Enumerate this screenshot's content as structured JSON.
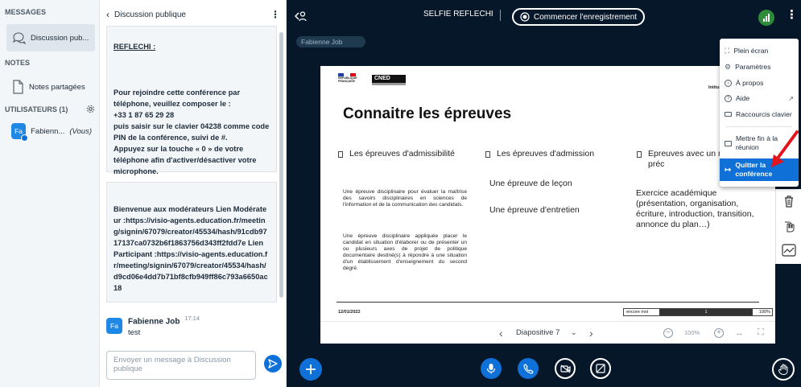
{
  "nav": {
    "messages_heading": "MESSAGES",
    "public_chat_label": "Discussion pub...",
    "notes_heading": "NOTES",
    "shared_notes_label": "Notes partagées",
    "users_heading": "UTILISATEURS (1)",
    "user": {
      "initials": "Fa",
      "name": "Fabienn...",
      "tag": "(Vous)",
      "avatar_color": "#1f88e5"
    }
  },
  "chat": {
    "title": "Discussion publique",
    "clipped_text": "REFLECHI :",
    "phone_message": "Pour rejoindre cette conférence par téléphone, veuillez composer le :\n+33 1 87 65 29 28\npuis saisir sur le clavier 04238 comme code PIN de la conférence, suivi de #.\nAppuyez sur la touche « 0 » de votre téléphone afin d'activer/désactiver votre microphone.",
    "moderator_message": "Bienvenue aux modérateurs Lien Modérateur :https://visio-agents.education.fr/meeting/signin/67079/creator/45534/hash/91cdb9717137ca0732b6f1863756d343ff2fdd7e Lien Participant :https://visio-agents.education.fr/meeting/signin/67079/creator/45534/hash/d9cd06e4dd7b71bf8cfb949ff86c793a6650ac18",
    "last_message": {
      "initials": "Fa",
      "author": "Fabienne Job",
      "time": "17:14",
      "text": "test"
    },
    "input_placeholder": "Envoyer un message à Discussion publique"
  },
  "topbar": {
    "title": "SELFIE REFLECHI",
    "record_label": "Commencer l'enregistrement",
    "presenter_name": "Fabienne Job"
  },
  "slide": {
    "logo_line1": "RÉPUBLIQUE",
    "logo_line2": "FRANÇAISE",
    "brand": "CNED",
    "top_right": "Intitulé de la d",
    "title": "Connaitre les épreuves",
    "columns": [
      {
        "heading": "Les épreuves d'admissibilité",
        "p1": "Une épreuve disciplinaire pour évaluer la maîtrise des savoirs disciplinaires en sciences de l'information et de la communication des candidats.",
        "p2": "Une épreuve disciplinaire appliquée placer le candidat en situation d'élaborer ou de présenter un ou plusieurs axes de projet de politique documentaire destiné(s) à répondre à une situation d'un établissement d'enseignement du second degré."
      },
      {
        "heading": "Les épreuves d'admission",
        "p1": "Une épreuve de leçon",
        "p2": "Une épreuve d'entretien"
      },
      {
        "heading": "Epreuves avec un méthodologie préc",
        "p1": "Exercice académique (présentation, organisation, écriture, introduction, transition, annonce du plan…)"
      }
    ],
    "footer_date": "12/01/2022",
    "footer_progress_label": "encore moi",
    "footer_progress_number": "1",
    "footer_percent": "100%"
  },
  "slide_toolbar": {
    "slide_label": "Diapositive 7",
    "zoom": "100%"
  },
  "menu": {
    "items": [
      {
        "label": "Plein écran",
        "icon": "fullscreen-icon"
      },
      {
        "label": "Paramètres",
        "icon": "gear-icon"
      },
      {
        "label": "À propos",
        "icon": "info-icon"
      },
      {
        "label": "Aide",
        "icon": "help-icon"
      },
      {
        "label": "Raccourcis clavier",
        "icon": "keyboard-icon"
      },
      {
        "label": "Mettre fin à la réunion",
        "icon": "end-meeting-icon"
      },
      {
        "label": "Quitter la conférence",
        "icon": "logout-icon"
      }
    ]
  },
  "colors": {
    "accent": "#0f70d7",
    "background": "#06172A",
    "connection": "#2e8b3a",
    "arrow": "#e3151c"
  }
}
